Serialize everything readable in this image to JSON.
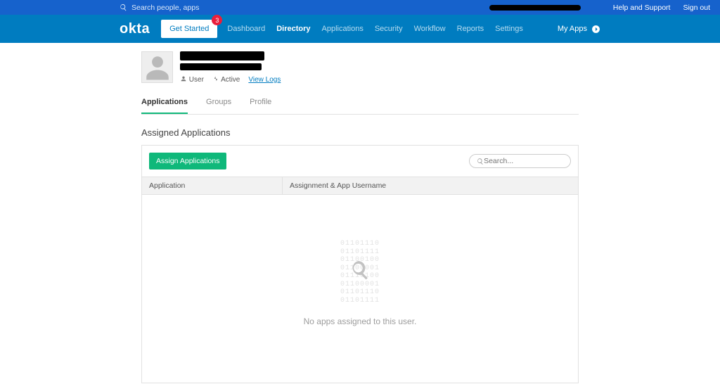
{
  "topbar": {
    "search_placeholder": "Search people, apps",
    "help_label": "Help and Support",
    "signout_label": "Sign out"
  },
  "mainbar": {
    "logo": "okta",
    "get_started_label": "Get Started",
    "badge_count": "3",
    "nav": {
      "dashboard": "Dashboard",
      "directory": "Directory",
      "applications": "Applications",
      "security": "Security",
      "workflow": "Workflow",
      "reports": "Reports",
      "settings": "Settings"
    },
    "myapps_label": "My Apps"
  },
  "profile": {
    "meta": {
      "user_label": "User",
      "active_label": "Active",
      "viewlogs_label": "View Logs"
    }
  },
  "tabs": {
    "applications": "Applications",
    "groups": "Groups",
    "profile": "Profile"
  },
  "section_title": "Assigned Applications",
  "panel": {
    "assign_button": "Assign Applications",
    "search_placeholder": "Search...",
    "col_application": "Application",
    "col_assignment": "Assignment & App Username",
    "empty_message": "No apps assigned to this user."
  }
}
